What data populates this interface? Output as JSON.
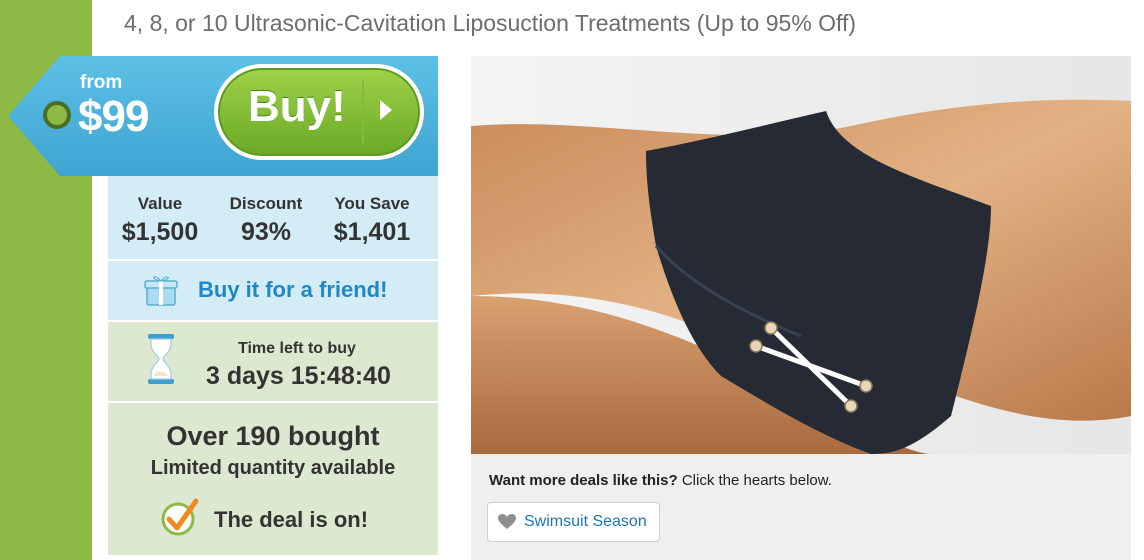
{
  "deal": {
    "title": "4, 8, or 10 Ultrasonic-Cavitation Liposuction Treatments (Up to 95% Off)"
  },
  "price_tag": {
    "from_label": "from",
    "price": "$99",
    "buy_label": "Buy!"
  },
  "stats": {
    "value_label": "Value",
    "value": "$1,500",
    "discount_label": "Discount",
    "discount": "93%",
    "save_label": "You Save",
    "save": "$1,401"
  },
  "gift": {
    "label": "Buy it for a friend!"
  },
  "timer": {
    "label": "Time left to buy",
    "value": "3 days 15:48:40"
  },
  "sales": {
    "bought": "Over 190 bought",
    "limited": "Limited quantity available",
    "status": "The deal is on!"
  },
  "more_deals": {
    "prompt_bold": "Want more deals like this?",
    "prompt_rest": " Click the hearts below.",
    "tag_label": "Swimsuit Season"
  },
  "colors": {
    "accent_green": "#8db945",
    "tag_blue": "#4cb2dc",
    "link_blue": "#1e88c8"
  },
  "icons": [
    "buy-arrow-icon",
    "gift-icon",
    "hourglass-icon",
    "check-icon",
    "heart-icon"
  ]
}
